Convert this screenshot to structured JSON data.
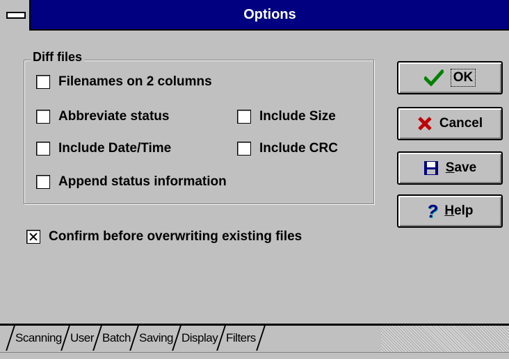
{
  "window": {
    "title": "Options"
  },
  "diff_group": {
    "label": "Diff files",
    "options": [
      {
        "label": "Filenames on 2 columns",
        "checked": false
      },
      {
        "label": "Abbreviate status",
        "checked": false
      },
      {
        "label": "Include Size",
        "checked": false
      },
      {
        "label": "Include Date/Time",
        "checked": false
      },
      {
        "label": "Include CRC",
        "checked": false
      },
      {
        "label": "Append status information",
        "checked": false
      }
    ]
  },
  "confirm": {
    "label": "Confirm before overwriting existing files",
    "checked": true
  },
  "buttons": {
    "ok": {
      "label": "OK",
      "icon": "checkmark-icon",
      "color": "#008000"
    },
    "cancel": {
      "label": "Cancel",
      "icon": "x-icon",
      "color": "#c00000"
    },
    "save": {
      "label_mnemonic": "S",
      "label_rest": "ave",
      "icon": "floppy-disk-icon",
      "color": "#000080"
    },
    "help": {
      "label_mnemonic": "H",
      "label_rest": "elp",
      "icon": "question-mark-icon",
      "color": "#000080"
    }
  },
  "tabs": [
    {
      "label": "Scanning",
      "active": false
    },
    {
      "label": "User",
      "active": false
    },
    {
      "label": "Batch",
      "active": false
    },
    {
      "label": "Saving",
      "active": true
    },
    {
      "label": "Display",
      "active": false
    },
    {
      "label": "Filters",
      "active": false
    }
  ]
}
